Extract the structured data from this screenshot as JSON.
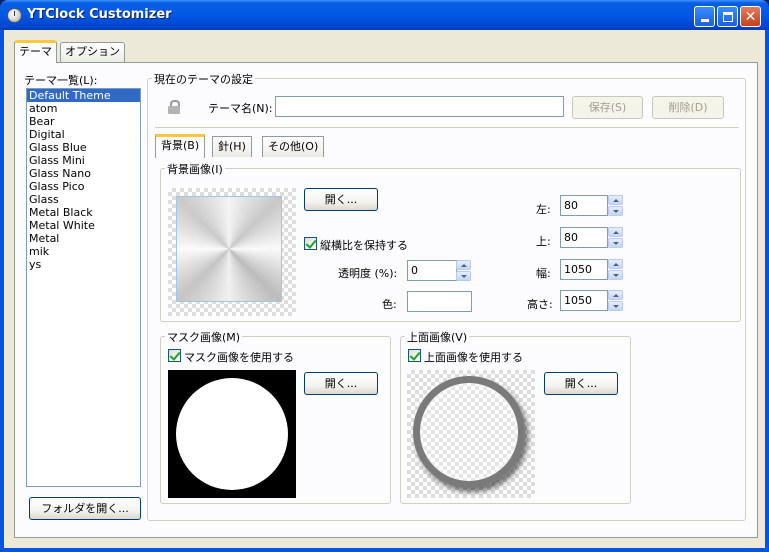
{
  "window": {
    "title": "YTClock Customizer"
  },
  "tabs": [
    {
      "label": "テーマ"
    },
    {
      "label": "オプション"
    }
  ],
  "theme_list": {
    "label": "テーマ一覧(L):",
    "items": [
      "Default Theme",
      "atom",
      "Bear",
      "Digital",
      "Glass Blue",
      "Glass Mini",
      "Glass Nano",
      "Glass Pico",
      "Glass",
      "Metal Black",
      "Metal White",
      "Metal",
      "mik",
      "ys"
    ],
    "selected_index": 0,
    "open_folder_label": "フォルダを開く..."
  },
  "settings": {
    "group_label": "現在のテーマの設定",
    "name_label": "テーマ名(N):",
    "name_value": "",
    "save_label": "保存(S)",
    "delete_label": "削除(D)"
  },
  "subtabs": [
    {
      "label": "背景(B)"
    },
    {
      "label": "針(H)"
    },
    {
      "label": "その他(O)"
    }
  ],
  "background": {
    "group_label": "背景画像(I)",
    "open_label": "開く...",
    "keep_aspect_label": "縦横比を保持する",
    "keep_aspect_checked": true,
    "opacity_label": "透明度 (%):",
    "opacity_value": "0",
    "color_label": "色:",
    "left_label": "左:",
    "left_value": "80",
    "top_label": "上:",
    "top_value": "80",
    "width_label": "幅:",
    "width_value": "1050",
    "height_label": "高さ:",
    "height_value": "1050"
  },
  "mask": {
    "group_label": "マスク画像(M)",
    "use_label": "マスク画像を使用する",
    "use_checked": true,
    "open_label": "開く..."
  },
  "overlay": {
    "group_label": "上面画像(V)",
    "use_label": "上面画像を使用する",
    "use_checked": true,
    "open_label": "開く..."
  }
}
